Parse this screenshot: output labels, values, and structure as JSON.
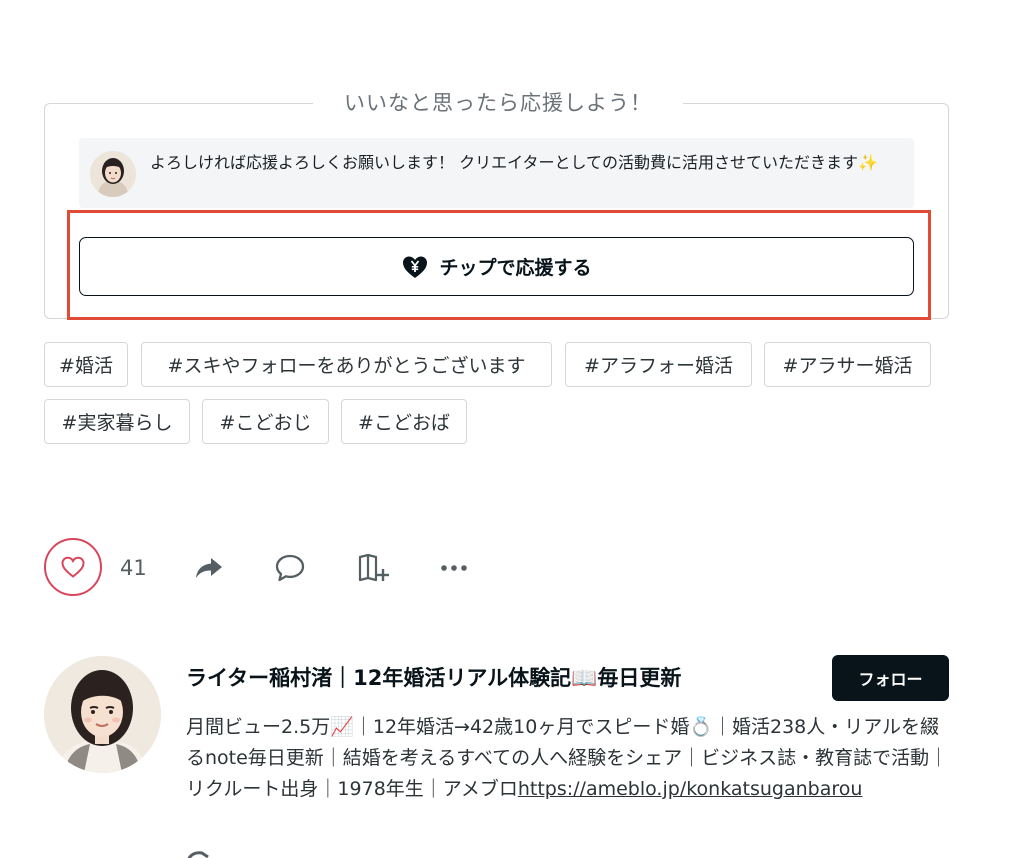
{
  "support": {
    "heading": "いいなと思ったら応援しよう！",
    "message": "よろしければ応援よろしくお願いします！ クリエイターとしての活動費に活用させていただきます✨",
    "tip_button_label": "チップで応援する"
  },
  "tags": [
    "#婚活",
    "#スキやフォローをありがとうございます",
    "#アラフォー婚活",
    "#アラサー婚活",
    "#実家暮らし",
    "#こどおじ",
    "#こどおば"
  ],
  "actions": {
    "like_count": "41",
    "icons": [
      "heart-icon",
      "share-icon",
      "comment-icon",
      "magazine-add-icon",
      "more-icon"
    ]
  },
  "author": {
    "name": "ライター稲村渚｜12年婚活リアル体験記📖毎日更新",
    "follow_label": "フォロー",
    "bio_text": "月間ビュー2.5万📈｜12年婚活→42歳10ヶ月でスピード婚💍｜婚活238人・リアルを綴るnote毎日更新｜結婚を考えるすべての人へ経験をシェア｜ビジネス誌・教育誌で活動｜リクルート出身｜1978年生｜アメブロ",
    "bio_link": "https://ameblo.jp/konkatsuganbarou"
  },
  "colors": {
    "highlight": "#e14a35",
    "like": "#d9465c",
    "text": "#08131a"
  }
}
